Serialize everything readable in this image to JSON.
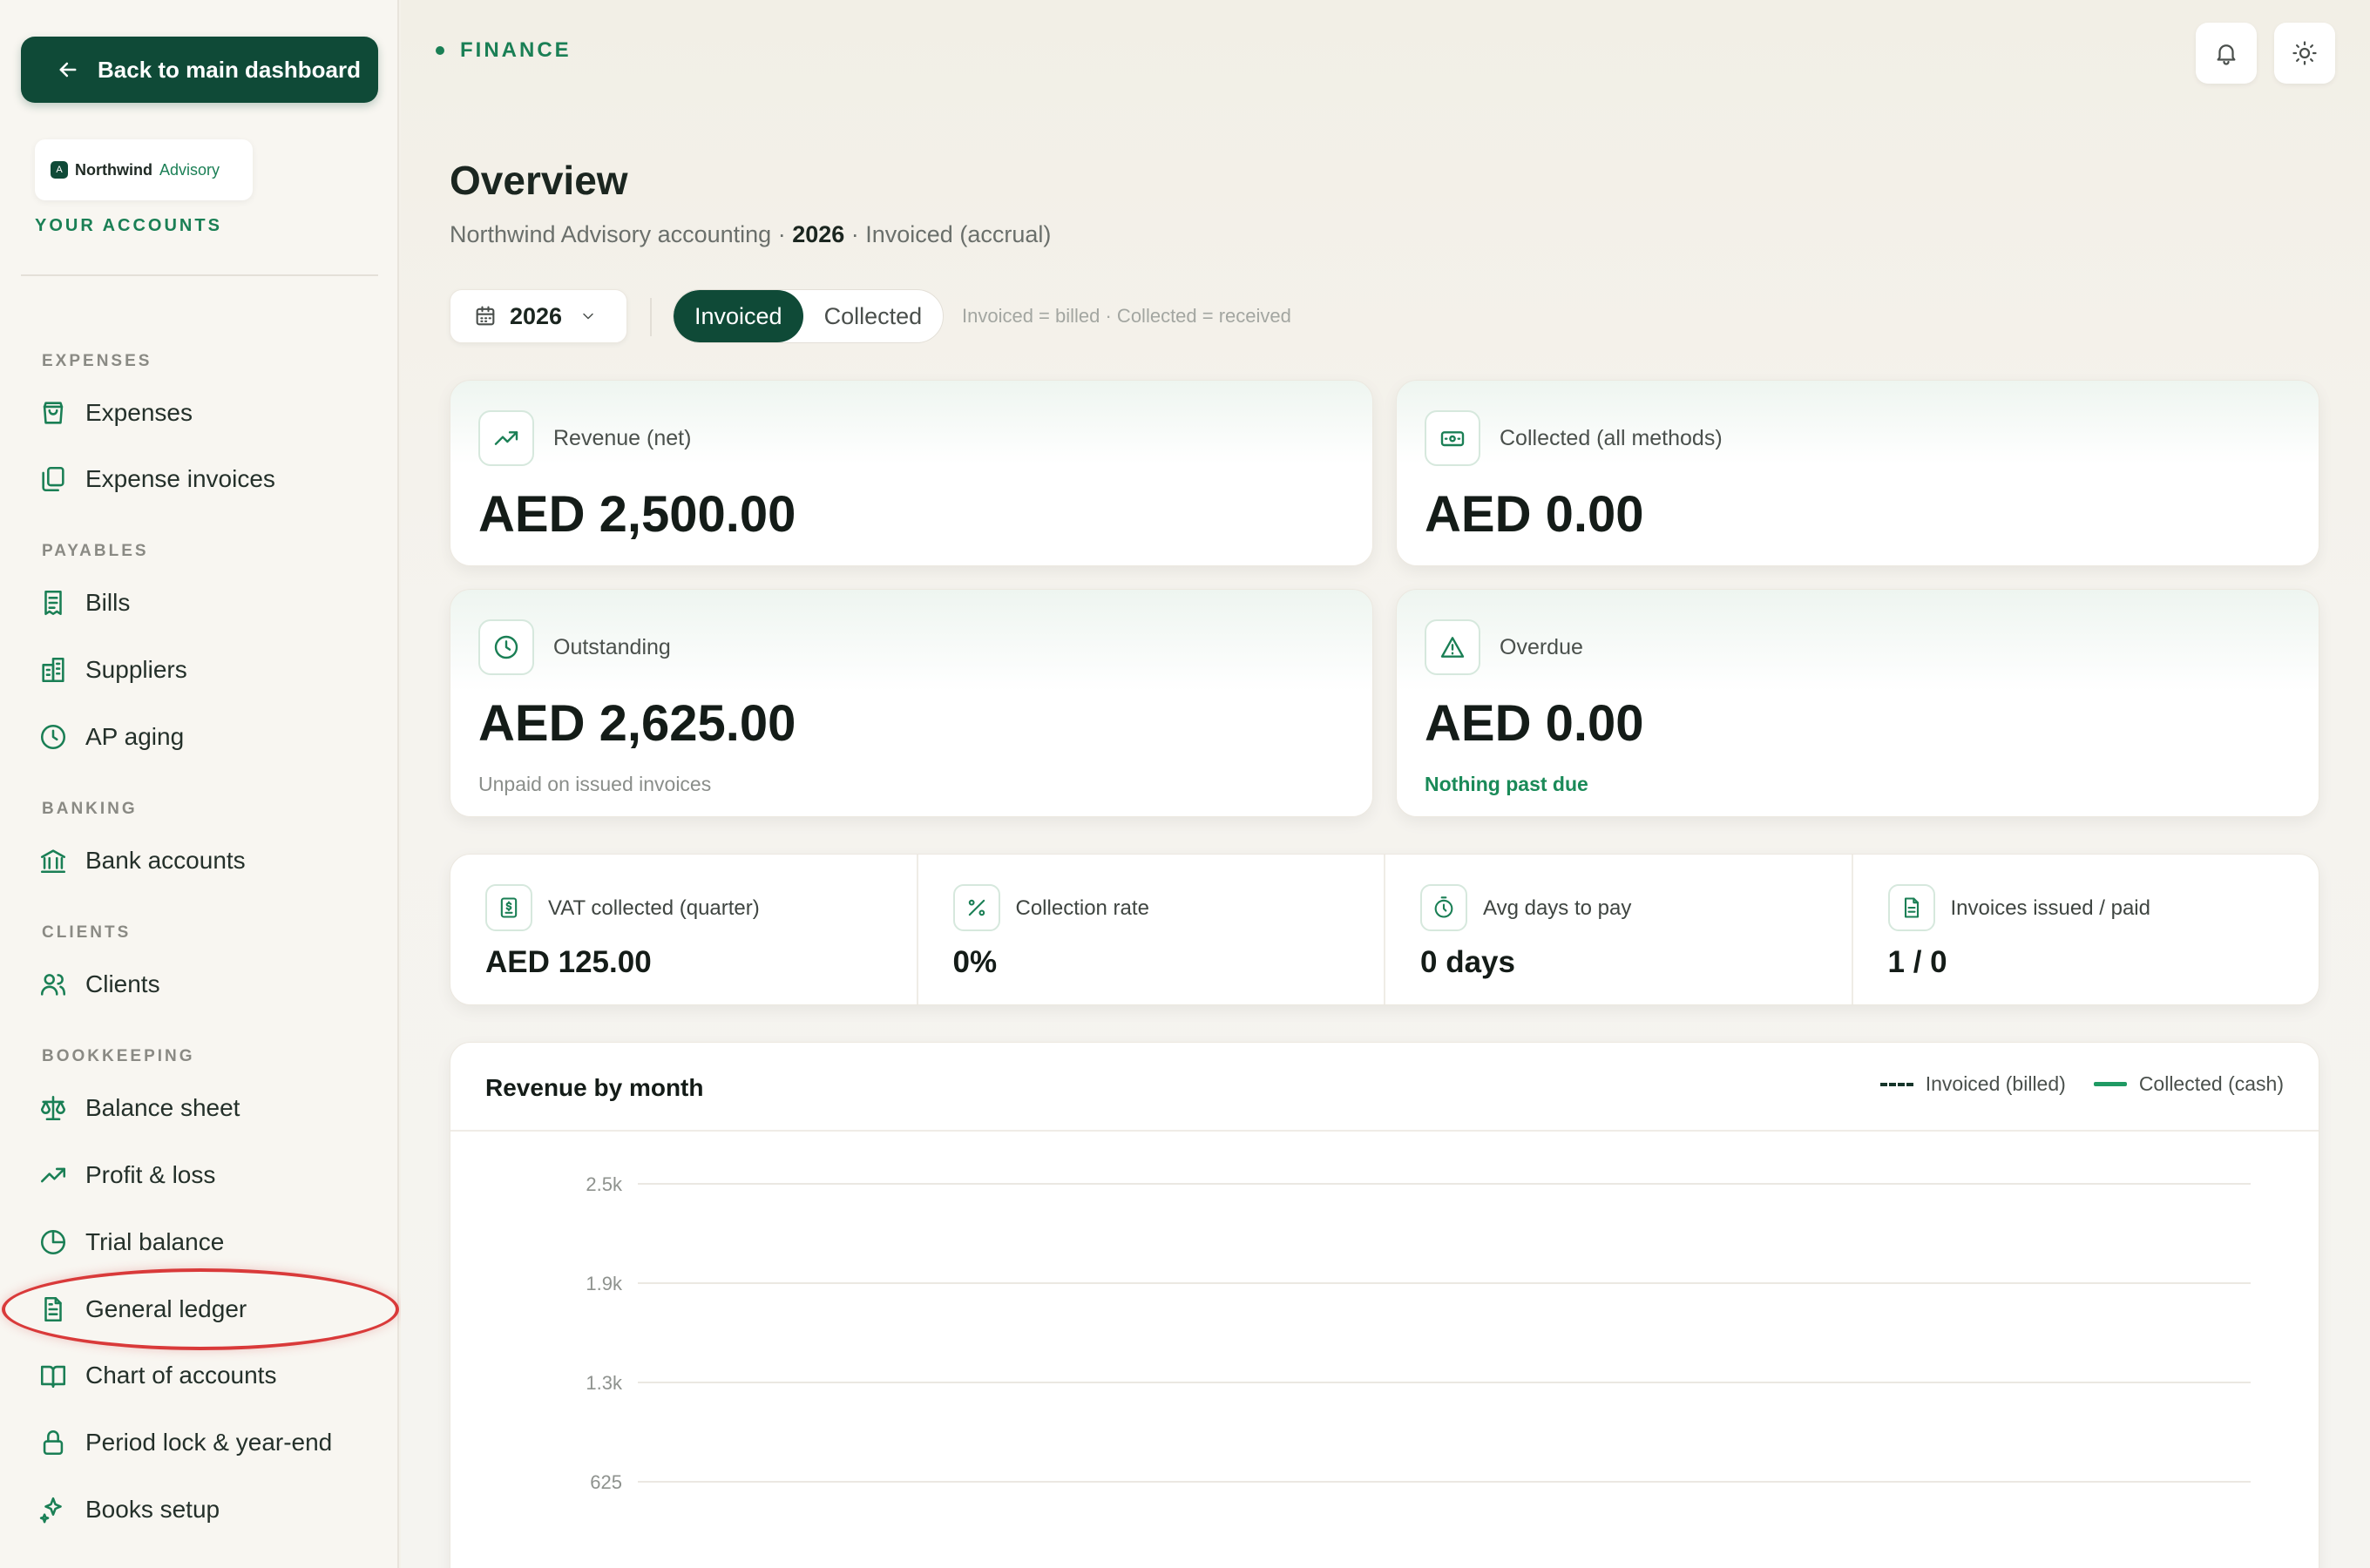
{
  "sidebar": {
    "back_label": "Back to main dashboard",
    "brand": {
      "name": "Northwind",
      "suffix": "Advisory",
      "mark": "A"
    },
    "accounts_label": "YOUR ACCOUNTS",
    "sections": {
      "expenses": "EXPENSES",
      "payables": "PAYABLES",
      "banking": "BANKING",
      "clients": "CLIENTS",
      "bookkeeping": "BOOKKEEPING"
    },
    "items": {
      "expenses": "Expenses",
      "expense_invoices": "Expense invoices",
      "bills": "Bills",
      "suppliers": "Suppliers",
      "ap_aging": "AP aging",
      "bank_accounts": "Bank accounts",
      "clients": "Clients",
      "balance_sheet": "Balance sheet",
      "profit_loss": "Profit & loss",
      "trial_balance": "Trial balance",
      "general_ledger": "General ledger",
      "chart_of_accounts": "Chart of accounts",
      "period_lock": "Period lock & year-end",
      "books_setup": "Books setup"
    }
  },
  "header": {
    "tag": "FINANCE",
    "title": "Overview",
    "subtitle_pre": "Northwind Advisory accounting · ",
    "subtitle_year": "2026",
    "subtitle_post": " · Invoiced (accrual)"
  },
  "filters": {
    "year": "2026",
    "toggle": [
      "Invoiced",
      "Collected"
    ],
    "active": "Invoiced",
    "hint": "Invoiced = billed · Collected = received"
  },
  "kpis": {
    "revenue": {
      "label": "Revenue (net)",
      "value": "AED 2,500.00"
    },
    "collected": {
      "label": "Collected (all methods)",
      "value": "AED 0.00"
    },
    "outstanding": {
      "label": "Outstanding",
      "value": "AED 2,625.00",
      "sub": "Unpaid on issued invoices"
    },
    "overdue": {
      "label": "Overdue",
      "value": "AED 0.00",
      "sub": "Nothing past due"
    }
  },
  "stats": {
    "vat": {
      "label": "VAT collected (quarter)",
      "value": "AED 125.00"
    },
    "collection_rate": {
      "label": "Collection rate",
      "value": "0%"
    },
    "avg_days": {
      "label": "Avg days to pay",
      "value": "0 days"
    },
    "issued_paid": {
      "label": "Invoices issued / paid",
      "value": "1 / 0"
    }
  },
  "chart": {
    "title": "Revenue by month",
    "legend": {
      "invoiced": "Invoiced (billed)",
      "collected": "Collected (cash)"
    }
  },
  "chart_data": {
    "type": "line",
    "title": "Revenue by month",
    "yticks": [
      "2.5k",
      "1.9k",
      "1.3k",
      "625"
    ],
    "series": [
      {
        "name": "Invoiced (billed)",
        "style": "dashed",
        "color": "#16352a"
      },
      {
        "name": "Collected (cash)",
        "style": "solid",
        "color": "#1f9a63"
      }
    ],
    "grid": true,
    "legend_position": "top-right"
  },
  "colors": {
    "accent": "#1a7f55",
    "brand_dark": "#0f4a37",
    "highlight": "#d93a3a"
  }
}
